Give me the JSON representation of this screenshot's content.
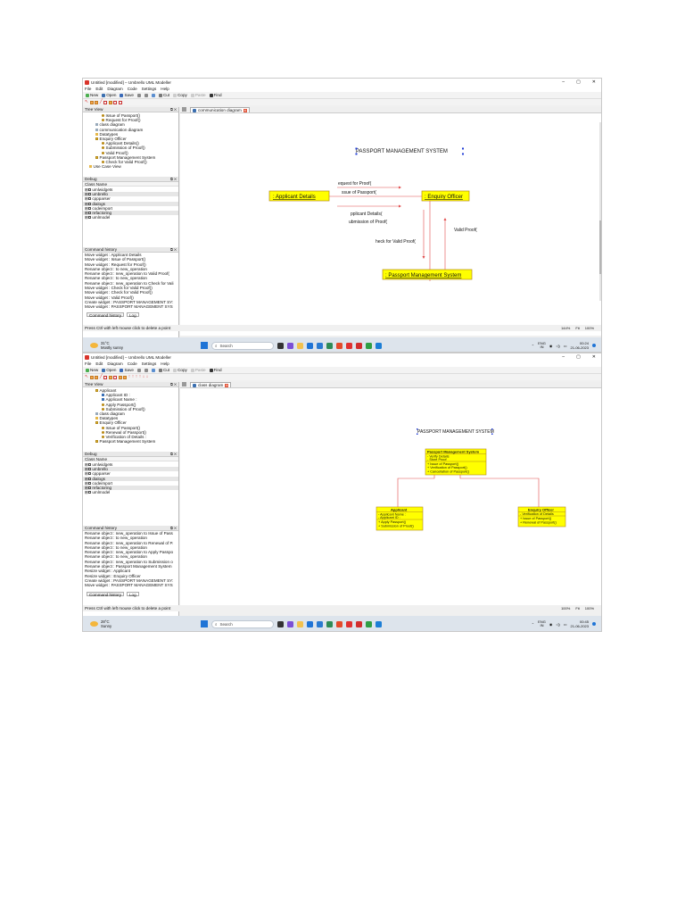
{
  "screenshot1": {
    "window_title": "Untitled [modified] – Umbrello UML Modeller",
    "menu": [
      "File",
      "Edit",
      "Diagram",
      "Code",
      "Settings",
      "Help"
    ],
    "toolbar": [
      "New",
      "Open",
      "Save",
      "Cut",
      "Copy",
      "Paste",
      "Find"
    ],
    "tree_view": {
      "title": "Tree View",
      "items": [
        {
          "label": "Issue of Passport()",
          "icon": "operation-icon",
          "indent": 3
        },
        {
          "label": "Request for Proof()",
          "icon": "operation-icon",
          "indent": 3
        },
        {
          "label": "class diagram",
          "icon": "diagram-icon",
          "indent": 2
        },
        {
          "label": "communication diagram",
          "icon": "diagram-icon",
          "indent": 2
        },
        {
          "label": "Datatypes",
          "icon": "folder-icon",
          "indent": 2
        },
        {
          "label": "Enquiry Officer",
          "icon": "class-icon",
          "indent": 2
        },
        {
          "label": "Applicant Details()",
          "icon": "operation-icon",
          "indent": 3
        },
        {
          "label": "Submission of Proof()",
          "icon": "operation-icon",
          "indent": 3
        },
        {
          "label": "Valid Proof()",
          "icon": "operation-icon",
          "indent": 3
        },
        {
          "label": "Passport Management System",
          "icon": "class-icon",
          "indent": 2
        },
        {
          "label": "Check for Valid Proof()",
          "icon": "operation-icon",
          "indent": 3
        },
        {
          "label": "Use Case View",
          "icon": "folder-icon",
          "indent": 1
        }
      ]
    },
    "debug": {
      "title": "Debug",
      "header": "Class Name",
      "items": [
        "umlwidgets",
        "umbrello",
        "cppparser",
        "dialogs",
        "codeimport",
        "refactoring",
        "umlmodel"
      ]
    },
    "command_history": {
      "title": "Command history",
      "items": [
        "Move widget : Applicant Details",
        "Move widget : Issue of Passport()",
        "Move widget : Request for Proof()",
        "Rename object : to new_operation",
        "Rename object : new_operation to Valid Proof(",
        "Rename object : to new_operation",
        "Rename object : new_operation to Check for Vali",
        "Move widget : Check for Valid Proof()",
        "Move widget : Check for Valid Proof()",
        "Move widget : Valid Proof()",
        "Create widget : PASSPORT MANAGEMENT SY:",
        "Move widget : PASSPORT MANAGEMENT SYS"
      ]
    },
    "bottom_tabs": [
      "Command history",
      "Log"
    ],
    "canvas_tab": "communication diagram",
    "diagram": {
      "title": "PASSPORT MANAGEMENT SYSTEM",
      "objects": [
        ": Applicant Details",
        ": Enquiry Officer",
        ": Passport Management System"
      ],
      "messages": [
        "equest for Proof(",
        "ssue of Passport(",
        "pplicant Details(",
        "ubmission of Proof(",
        "heck for Valid Proof(",
        "Valid Proof("
      ]
    },
    "status": "Press Ctrl with left mouse click to delete a point",
    "zoom": [
      "144%",
      "Fit",
      "100%"
    ],
    "taskbar": {
      "weather_temp": "31°C",
      "weather_desc": "Mostly sunny",
      "search": "Search",
      "lang": [
        "ENG",
        "IN"
      ],
      "time": "00:24",
      "date": "21-06-2023"
    }
  },
  "screenshot2": {
    "window_title": "Untitled [modified] – Umbrello UML Modeller",
    "menu": [
      "File",
      "Edit",
      "Diagram",
      "Code",
      "Settings",
      "Help"
    ],
    "toolbar": [
      "New",
      "Open",
      "Save",
      "Cut",
      "Copy",
      "Paste",
      "Find"
    ],
    "tree_view": {
      "title": "Tree View",
      "items": [
        {
          "label": "Applicant",
          "icon": "class-icon",
          "indent": 2
        },
        {
          "label": "Applicant ID :",
          "icon": "attribute-icon",
          "indent": 3
        },
        {
          "label": "Applicant Name :",
          "icon": "attribute-icon",
          "indent": 3
        },
        {
          "label": "Apply Passport()",
          "icon": "operation-icon",
          "indent": 3
        },
        {
          "label": "Submission of Proof()",
          "icon": "operation-icon",
          "indent": 3
        },
        {
          "label": "class diagram",
          "icon": "diagram-icon",
          "indent": 2
        },
        {
          "label": "Datatypes",
          "icon": "folder-icon",
          "indent": 2
        },
        {
          "label": "Enquiry Officer",
          "icon": "class-icon",
          "indent": 2
        },
        {
          "label": "Issue of Passport()",
          "icon": "operation-icon",
          "indent": 3
        },
        {
          "label": "Renewal of Passport()",
          "icon": "operation-icon",
          "indent": 3
        },
        {
          "label": "Verification of Details :",
          "icon": "operation-icon",
          "indent": 3
        },
        {
          "label": "Passport Management System",
          "icon": "class-icon",
          "indent": 2
        }
      ]
    },
    "debug": {
      "title": "Debug",
      "header": "Class Name",
      "items": [
        "umlwidgets",
        "umbrello",
        "cppparser",
        "dialogs",
        "codeimport",
        "refactoring",
        "umlmodel"
      ]
    },
    "command_history": {
      "title": "Command history",
      "items": [
        "Rename object : new_operation to Issue of Pass",
        "Rename object : to new_operation",
        "Rename object : new_operation to Renewal of P.",
        "Rename object : to new_operation",
        "Rename object : new_operation to Apply Passpo",
        "Rename object : to new_operation",
        "Rename object : new_operation to Submission o",
        "Rename object : Passport Management System",
        "Resize widget : Applicant",
        "Resize widget : Enquiry Officer",
        "Create widget : PASSPORT MANAGEMENT SY:",
        "Move widget : PASSPORT MANAGEMENT SYS"
      ]
    },
    "bottom_tabs": [
      "Command history",
      "Log"
    ],
    "canvas_tab": "class diagram",
    "diagram": {
      "title": "PASSPORT MANAGEMENT SYSTEM",
      "classes": [
        {
          "name": "Passport Management System",
          "attributes": [
            "- Verify Details",
            "- Store Proof"
          ],
          "operations": [
            "+ Issue of Passport()",
            "+ Verification of Passport()",
            "+ Cancellation of Passport()"
          ]
        },
        {
          "name": "Applicant",
          "attributes": [
            "- Applicant Name :",
            "- Applicant ID :"
          ],
          "operations": [
            "+ Apply Passport()",
            "+ Submission of Proof()"
          ]
        },
        {
          "name": "Enquiry Officer",
          "attributes": [
            "- Verification of Details"
          ],
          "operations": [
            "+ Issue of Passport()",
            "+ Renewal of Passport()"
          ]
        }
      ]
    },
    "status": "Press Ctrl with left mouse click to delete a point",
    "zoom": [
      "100%",
      "Fit",
      "100%"
    ],
    "taskbar": {
      "weather_temp": "28°C",
      "weather_desc": "Sunny",
      "search": "Search",
      "lang": [
        "ENG",
        "IN"
      ],
      "time": "00:45",
      "date": "21-06-2023"
    }
  },
  "colors": {
    "uml_fill": "#ffff00",
    "uml_border": "#b58a18",
    "connector": "#e04a4a",
    "selection_handle": "#1f3bd6"
  }
}
